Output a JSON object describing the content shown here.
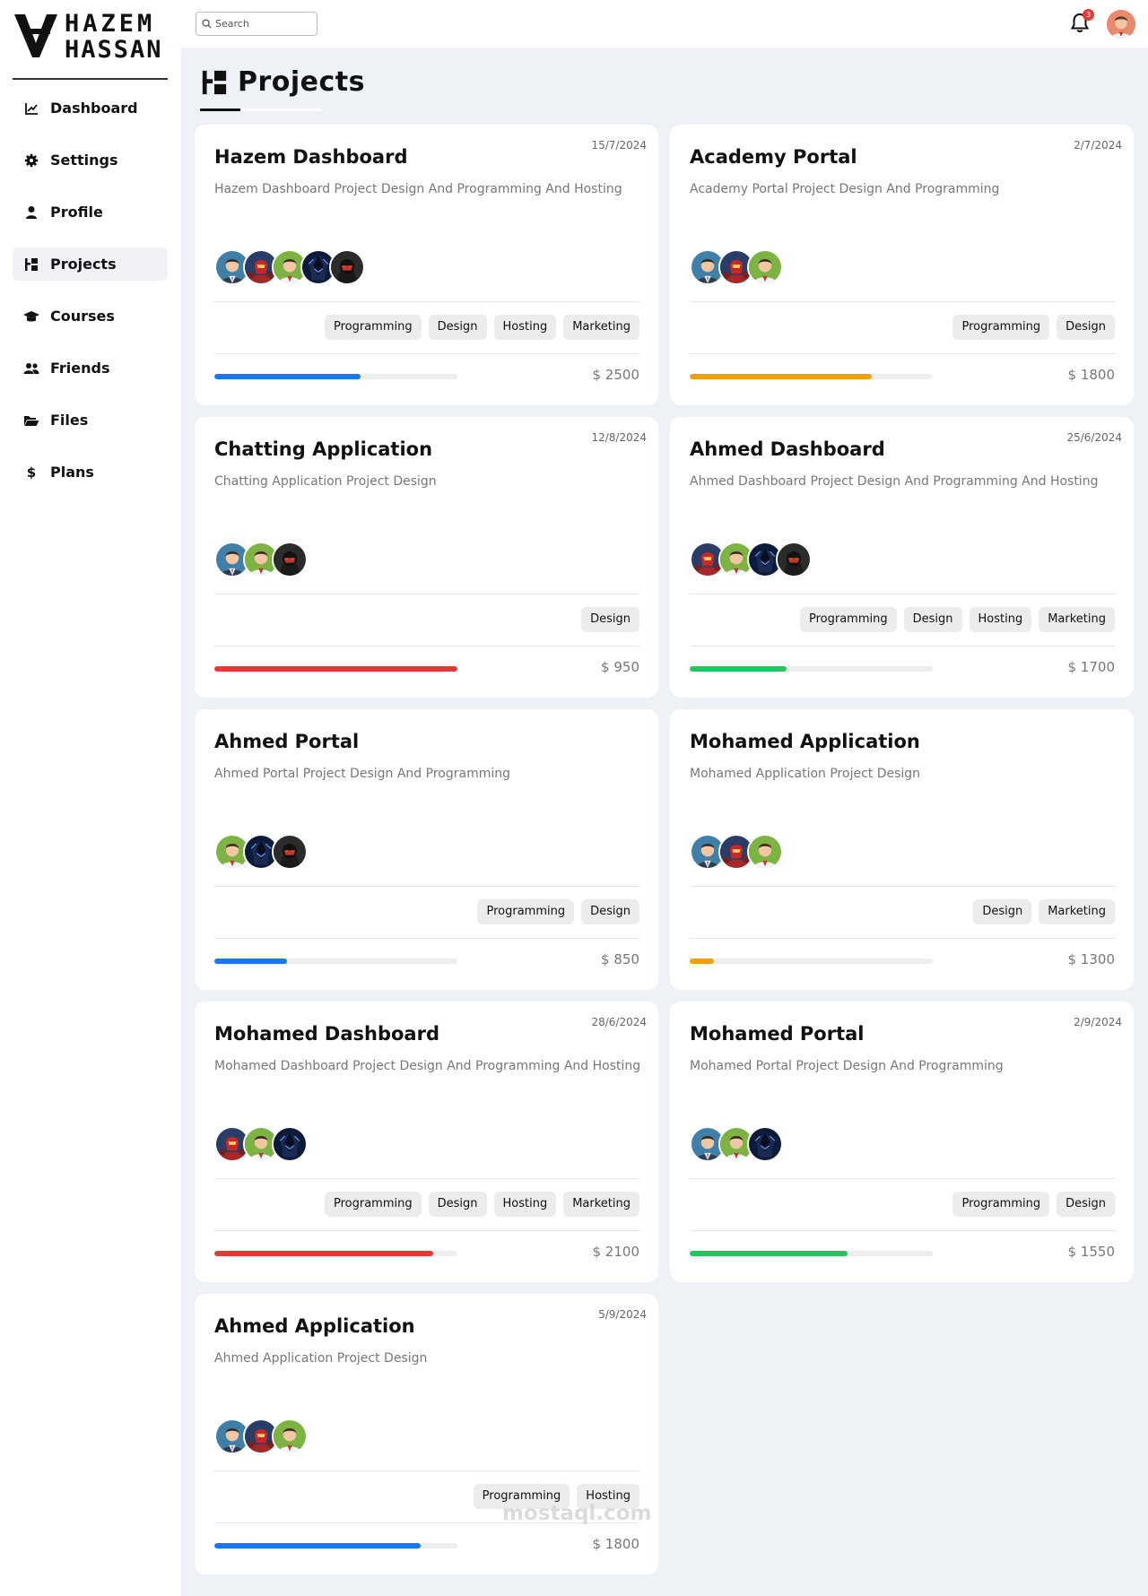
{
  "brand": {
    "line1": "HAZEM",
    "line2": "HASSAN"
  },
  "sidebar": {
    "items": [
      {
        "label": "Dashboard",
        "icon": "chart-line-icon",
        "active": false
      },
      {
        "label": "Settings",
        "icon": "gear-icon",
        "active": false
      },
      {
        "label": "Profile",
        "icon": "user-icon",
        "active": false
      },
      {
        "label": "Projects",
        "icon": "diagram-project-icon",
        "active": true
      },
      {
        "label": "Courses",
        "icon": "graduation-cap-icon",
        "active": false
      },
      {
        "label": "Friends",
        "icon": "users-icon",
        "active": false
      },
      {
        "label": "Files",
        "icon": "folder-open-icon",
        "active": false
      },
      {
        "label": "Plans",
        "icon": "dollar-icon",
        "active": false
      }
    ]
  },
  "header": {
    "search_placeholder": "Search",
    "notifications_count": "3"
  },
  "page": {
    "title": "Projects"
  },
  "colors": {
    "blue": "#1877f2",
    "orange": "#f59e0b",
    "red": "#e53935",
    "green": "#22c55e"
  },
  "projects": [
    {
      "title": "Hazem Dashboard",
      "date": "15/7/2024",
      "desc": "Hazem Dashboard Project Design And Programming And Hosting",
      "members": [
        "man-suit",
        "red-robot",
        "man-green",
        "dark-knight",
        "red-ninja"
      ],
      "tags": [
        "Programming",
        "Design",
        "Hosting",
        "Marketing"
      ],
      "progress": 0.6,
      "color": "#1877f2",
      "price": "$ 2500"
    },
    {
      "title": "Academy Portal",
      "date": "2/7/2024",
      "desc": "Academy Portal Project Design And Programming",
      "members": [
        "man-suit",
        "red-robot",
        "man-green"
      ],
      "tags": [
        "Programming",
        "Design"
      ],
      "progress": 0.75,
      "color": "#f59e0b",
      "price": "$ 1800"
    },
    {
      "title": "Chatting Application",
      "date": "12/8/2024",
      "desc": "Chatting Application Project Design",
      "members": [
        "man-suit",
        "man-green",
        "red-ninja"
      ],
      "tags": [
        "Design"
      ],
      "progress": 1.0,
      "color": "#e53935",
      "price": "$ 950"
    },
    {
      "title": "Ahmed Dashboard",
      "date": "25/6/2024",
      "desc": "Ahmed Dashboard Project Design And Programming And Hosting",
      "members": [
        "red-robot",
        "man-green",
        "dark-knight",
        "red-ninja"
      ],
      "tags": [
        "Programming",
        "Design",
        "Hosting",
        "Marketing"
      ],
      "progress": 0.4,
      "color": "#22c55e",
      "price": "$ 1700"
    },
    {
      "title": "Ahmed Portal",
      "date": "",
      "desc": "Ahmed Portal Project Design And Programming",
      "members": [
        "man-green",
        "dark-knight",
        "red-ninja"
      ],
      "tags": [
        "Programming",
        "Design"
      ],
      "progress": 0.3,
      "color": "#1877f2",
      "price": "$ 850"
    },
    {
      "title": "Mohamed Application",
      "date": "",
      "desc": "Mohamed Application Project Design",
      "members": [
        "man-suit",
        "red-robot",
        "man-green"
      ],
      "tags": [
        "Design",
        "Marketing"
      ],
      "progress": 0.1,
      "color": "#f59e0b",
      "price": "$ 1300"
    },
    {
      "title": "Mohamed Dashboard",
      "date": "28/6/2024",
      "desc": "Mohamed Dashboard Project Design And Programming And Hosting",
      "members": [
        "red-robot",
        "man-green",
        "dark-knight"
      ],
      "tags": [
        "Programming",
        "Design",
        "Hosting",
        "Marketing"
      ],
      "progress": 0.9,
      "color": "#e53935",
      "price": "$ 2100"
    },
    {
      "title": "Mohamed Portal",
      "date": "2/9/2024",
      "desc": "Mohamed Portal Project Design And Programming",
      "members": [
        "man-suit",
        "man-green",
        "dark-knight"
      ],
      "tags": [
        "Programming",
        "Design"
      ],
      "progress": 0.65,
      "color": "#22c55e",
      "price": "$ 1550"
    },
    {
      "title": "Ahmed Application",
      "date": "5/9/2024",
      "desc": "Ahmed Application Project Design",
      "members": [
        "man-suit",
        "red-robot",
        "man-green"
      ],
      "tags": [
        "Programming",
        "Hosting"
      ],
      "progress": 0.85,
      "color": "#1877f2",
      "price": "$ 1800"
    }
  ],
  "watermark": "mostaql.com"
}
